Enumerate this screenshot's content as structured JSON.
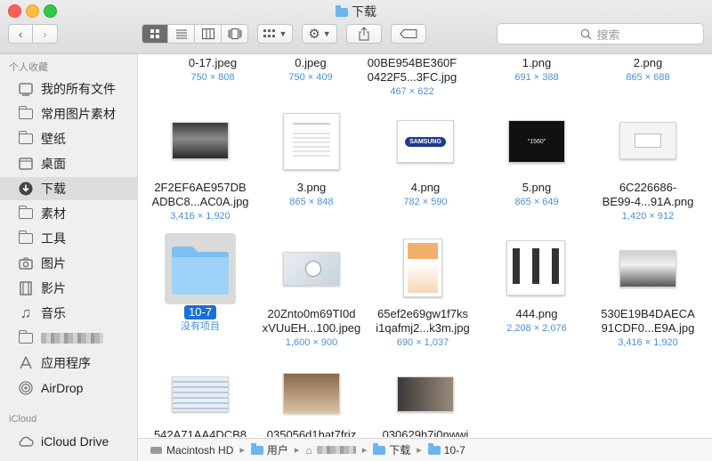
{
  "window": {
    "title": "下载"
  },
  "toolbar": {
    "search_placeholder": "搜索"
  },
  "sidebar": {
    "favorites_header": "个人收藏",
    "items": [
      {
        "label": "我的所有文件",
        "icon": "all-files-icon"
      },
      {
        "label": "常用图片素材",
        "icon": "folder-icon"
      },
      {
        "label": "壁纸",
        "icon": "folder-icon"
      },
      {
        "label": "桌面",
        "icon": "desktop-icon"
      },
      {
        "label": "下载",
        "icon": "download-icon",
        "selected": true
      },
      {
        "label": "素材",
        "icon": "folder-icon"
      },
      {
        "label": "工具",
        "icon": "folder-icon"
      },
      {
        "label": "图片",
        "icon": "camera-icon"
      },
      {
        "label": "影片",
        "icon": "film-icon"
      },
      {
        "label": "音乐",
        "icon": "music-icon"
      },
      {
        "label": "",
        "icon": "folder-icon",
        "blurred": true
      },
      {
        "label": "应用程序",
        "icon": "apps-icon"
      },
      {
        "label": "AirDrop",
        "icon": "airdrop-icon"
      }
    ],
    "icloud_header": "iCloud",
    "icloud_items": [
      {
        "label": "iCloud Drive",
        "icon": "cloud-icon"
      }
    ]
  },
  "files": {
    "row1": [
      {
        "name": "0-17.jpeg",
        "dims": "750 × 808"
      },
      {
        "name": "0.jpeg",
        "dims": "750 × 409"
      },
      {
        "name": "00BE954BE360F",
        "name2": "0422F5...3FC.jpg",
        "dims": "467 × 622"
      },
      {
        "name": "1.png",
        "dims": "691 × 388"
      },
      {
        "name": "2.png",
        "dims": "865 × 688"
      }
    ],
    "row2": [
      {
        "name": "2F2EF6AE957DB",
        "name2": "ADBC8...AC0A.jpg",
        "dims": "3,416 × 1,920"
      },
      {
        "name": "3.png",
        "dims": "865 × 848"
      },
      {
        "name": "4.png",
        "dims": "782 × 590",
        "thumb_text": "SAMSUNG"
      },
      {
        "name": "5.png",
        "dims": "865 × 649",
        "thumb_text": "\"1560\""
      },
      {
        "name": "6C226686-",
        "name2": "BE99-4...91A.png",
        "dims": "1,420 × 912"
      }
    ],
    "row3": [
      {
        "name": "10-7",
        "dims": "没有项目"
      },
      {
        "name": "20Znto0m69TI0d",
        "name2": "xVUuEH...100.jpeg",
        "dims": "1,600 × 900"
      },
      {
        "name": "65ef2e69gw1f7ks",
        "name2": "i1qafmj2...k3m.jpg",
        "dims": "690 × 1,037"
      },
      {
        "name": "444.png",
        "dims": "2,208 × 2,076"
      },
      {
        "name": "530E19B4DAECA",
        "name2": "91CDF0...E9A.jpg",
        "dims": "3,416 × 1,920"
      }
    ],
    "row4": [
      {
        "name": "542A71AA4DCB8"
      },
      {
        "name": "035056d1hat7friz"
      },
      {
        "name": "030629h7i0nwwi"
      }
    ]
  },
  "pathbar": {
    "items": [
      "Macintosh HD",
      "用户",
      "",
      "下载",
      "10-7"
    ]
  }
}
